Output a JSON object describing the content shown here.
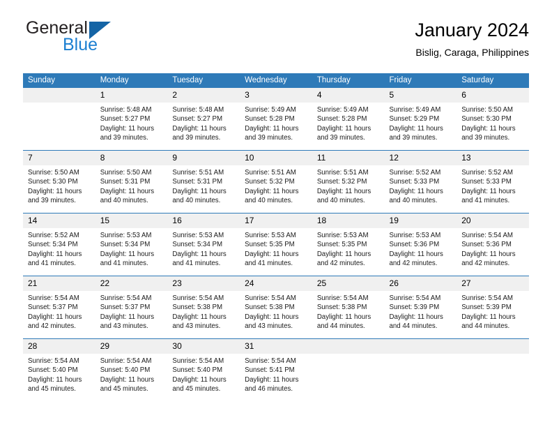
{
  "brand": {
    "name_top": "General",
    "name_bottom": "Blue",
    "accent_color": "#1464a5",
    "blue_text_color": "#1c7fd1"
  },
  "header": {
    "title": "January 2024",
    "subtitle": "Bislig, Caraga, Philippines"
  },
  "theme": {
    "header_row_bg": "#2e7ab8",
    "daynum_bg": "#f0f0f0",
    "grid_line": "#2e7ab8"
  },
  "weekday_headers": [
    "Sunday",
    "Monday",
    "Tuesday",
    "Wednesday",
    "Thursday",
    "Friday",
    "Saturday"
  ],
  "weeks": [
    [
      {
        "day": "",
        "sunrise": "",
        "sunset": "",
        "daylight_1": "",
        "daylight_2": ""
      },
      {
        "day": "1",
        "sunrise": "Sunrise: 5:48 AM",
        "sunset": "Sunset: 5:27 PM",
        "daylight_1": "Daylight: 11 hours",
        "daylight_2": "and 39 minutes."
      },
      {
        "day": "2",
        "sunrise": "Sunrise: 5:48 AM",
        "sunset": "Sunset: 5:27 PM",
        "daylight_1": "Daylight: 11 hours",
        "daylight_2": "and 39 minutes."
      },
      {
        "day": "3",
        "sunrise": "Sunrise: 5:49 AM",
        "sunset": "Sunset: 5:28 PM",
        "daylight_1": "Daylight: 11 hours",
        "daylight_2": "and 39 minutes."
      },
      {
        "day": "4",
        "sunrise": "Sunrise: 5:49 AM",
        "sunset": "Sunset: 5:28 PM",
        "daylight_1": "Daylight: 11 hours",
        "daylight_2": "and 39 minutes."
      },
      {
        "day": "5",
        "sunrise": "Sunrise: 5:49 AM",
        "sunset": "Sunset: 5:29 PM",
        "daylight_1": "Daylight: 11 hours",
        "daylight_2": "and 39 minutes."
      },
      {
        "day": "6",
        "sunrise": "Sunrise: 5:50 AM",
        "sunset": "Sunset: 5:30 PM",
        "daylight_1": "Daylight: 11 hours",
        "daylight_2": "and 39 minutes."
      }
    ],
    [
      {
        "day": "7",
        "sunrise": "Sunrise: 5:50 AM",
        "sunset": "Sunset: 5:30 PM",
        "daylight_1": "Daylight: 11 hours",
        "daylight_2": "and 39 minutes."
      },
      {
        "day": "8",
        "sunrise": "Sunrise: 5:50 AM",
        "sunset": "Sunset: 5:31 PM",
        "daylight_1": "Daylight: 11 hours",
        "daylight_2": "and 40 minutes."
      },
      {
        "day": "9",
        "sunrise": "Sunrise: 5:51 AM",
        "sunset": "Sunset: 5:31 PM",
        "daylight_1": "Daylight: 11 hours",
        "daylight_2": "and 40 minutes."
      },
      {
        "day": "10",
        "sunrise": "Sunrise: 5:51 AM",
        "sunset": "Sunset: 5:32 PM",
        "daylight_1": "Daylight: 11 hours",
        "daylight_2": "and 40 minutes."
      },
      {
        "day": "11",
        "sunrise": "Sunrise: 5:51 AM",
        "sunset": "Sunset: 5:32 PM",
        "daylight_1": "Daylight: 11 hours",
        "daylight_2": "and 40 minutes."
      },
      {
        "day": "12",
        "sunrise": "Sunrise: 5:52 AM",
        "sunset": "Sunset: 5:33 PM",
        "daylight_1": "Daylight: 11 hours",
        "daylight_2": "and 40 minutes."
      },
      {
        "day": "13",
        "sunrise": "Sunrise: 5:52 AM",
        "sunset": "Sunset: 5:33 PM",
        "daylight_1": "Daylight: 11 hours",
        "daylight_2": "and 41 minutes."
      }
    ],
    [
      {
        "day": "14",
        "sunrise": "Sunrise: 5:52 AM",
        "sunset": "Sunset: 5:34 PM",
        "daylight_1": "Daylight: 11 hours",
        "daylight_2": "and 41 minutes."
      },
      {
        "day": "15",
        "sunrise": "Sunrise: 5:53 AM",
        "sunset": "Sunset: 5:34 PM",
        "daylight_1": "Daylight: 11 hours",
        "daylight_2": "and 41 minutes."
      },
      {
        "day": "16",
        "sunrise": "Sunrise: 5:53 AM",
        "sunset": "Sunset: 5:34 PM",
        "daylight_1": "Daylight: 11 hours",
        "daylight_2": "and 41 minutes."
      },
      {
        "day": "17",
        "sunrise": "Sunrise: 5:53 AM",
        "sunset": "Sunset: 5:35 PM",
        "daylight_1": "Daylight: 11 hours",
        "daylight_2": "and 41 minutes."
      },
      {
        "day": "18",
        "sunrise": "Sunrise: 5:53 AM",
        "sunset": "Sunset: 5:35 PM",
        "daylight_1": "Daylight: 11 hours",
        "daylight_2": "and 42 minutes."
      },
      {
        "day": "19",
        "sunrise": "Sunrise: 5:53 AM",
        "sunset": "Sunset: 5:36 PM",
        "daylight_1": "Daylight: 11 hours",
        "daylight_2": "and 42 minutes."
      },
      {
        "day": "20",
        "sunrise": "Sunrise: 5:54 AM",
        "sunset": "Sunset: 5:36 PM",
        "daylight_1": "Daylight: 11 hours",
        "daylight_2": "and 42 minutes."
      }
    ],
    [
      {
        "day": "21",
        "sunrise": "Sunrise: 5:54 AM",
        "sunset": "Sunset: 5:37 PM",
        "daylight_1": "Daylight: 11 hours",
        "daylight_2": "and 42 minutes."
      },
      {
        "day": "22",
        "sunrise": "Sunrise: 5:54 AM",
        "sunset": "Sunset: 5:37 PM",
        "daylight_1": "Daylight: 11 hours",
        "daylight_2": "and 43 minutes."
      },
      {
        "day": "23",
        "sunrise": "Sunrise: 5:54 AM",
        "sunset": "Sunset: 5:38 PM",
        "daylight_1": "Daylight: 11 hours",
        "daylight_2": "and 43 minutes."
      },
      {
        "day": "24",
        "sunrise": "Sunrise: 5:54 AM",
        "sunset": "Sunset: 5:38 PM",
        "daylight_1": "Daylight: 11 hours",
        "daylight_2": "and 43 minutes."
      },
      {
        "day": "25",
        "sunrise": "Sunrise: 5:54 AM",
        "sunset": "Sunset: 5:38 PM",
        "daylight_1": "Daylight: 11 hours",
        "daylight_2": "and 44 minutes."
      },
      {
        "day": "26",
        "sunrise": "Sunrise: 5:54 AM",
        "sunset": "Sunset: 5:39 PM",
        "daylight_1": "Daylight: 11 hours",
        "daylight_2": "and 44 minutes."
      },
      {
        "day": "27",
        "sunrise": "Sunrise: 5:54 AM",
        "sunset": "Sunset: 5:39 PM",
        "daylight_1": "Daylight: 11 hours",
        "daylight_2": "and 44 minutes."
      }
    ],
    [
      {
        "day": "28",
        "sunrise": "Sunrise: 5:54 AM",
        "sunset": "Sunset: 5:40 PM",
        "daylight_1": "Daylight: 11 hours",
        "daylight_2": "and 45 minutes."
      },
      {
        "day": "29",
        "sunrise": "Sunrise: 5:54 AM",
        "sunset": "Sunset: 5:40 PM",
        "daylight_1": "Daylight: 11 hours",
        "daylight_2": "and 45 minutes."
      },
      {
        "day": "30",
        "sunrise": "Sunrise: 5:54 AM",
        "sunset": "Sunset: 5:40 PM",
        "daylight_1": "Daylight: 11 hours",
        "daylight_2": "and 45 minutes."
      },
      {
        "day": "31",
        "sunrise": "Sunrise: 5:54 AM",
        "sunset": "Sunset: 5:41 PM",
        "daylight_1": "Daylight: 11 hours",
        "daylight_2": "and 46 minutes."
      },
      {
        "day": "",
        "sunrise": "",
        "sunset": "",
        "daylight_1": "",
        "daylight_2": ""
      },
      {
        "day": "",
        "sunrise": "",
        "sunset": "",
        "daylight_1": "",
        "daylight_2": ""
      },
      {
        "day": "",
        "sunrise": "",
        "sunset": "",
        "daylight_1": "",
        "daylight_2": ""
      }
    ]
  ]
}
